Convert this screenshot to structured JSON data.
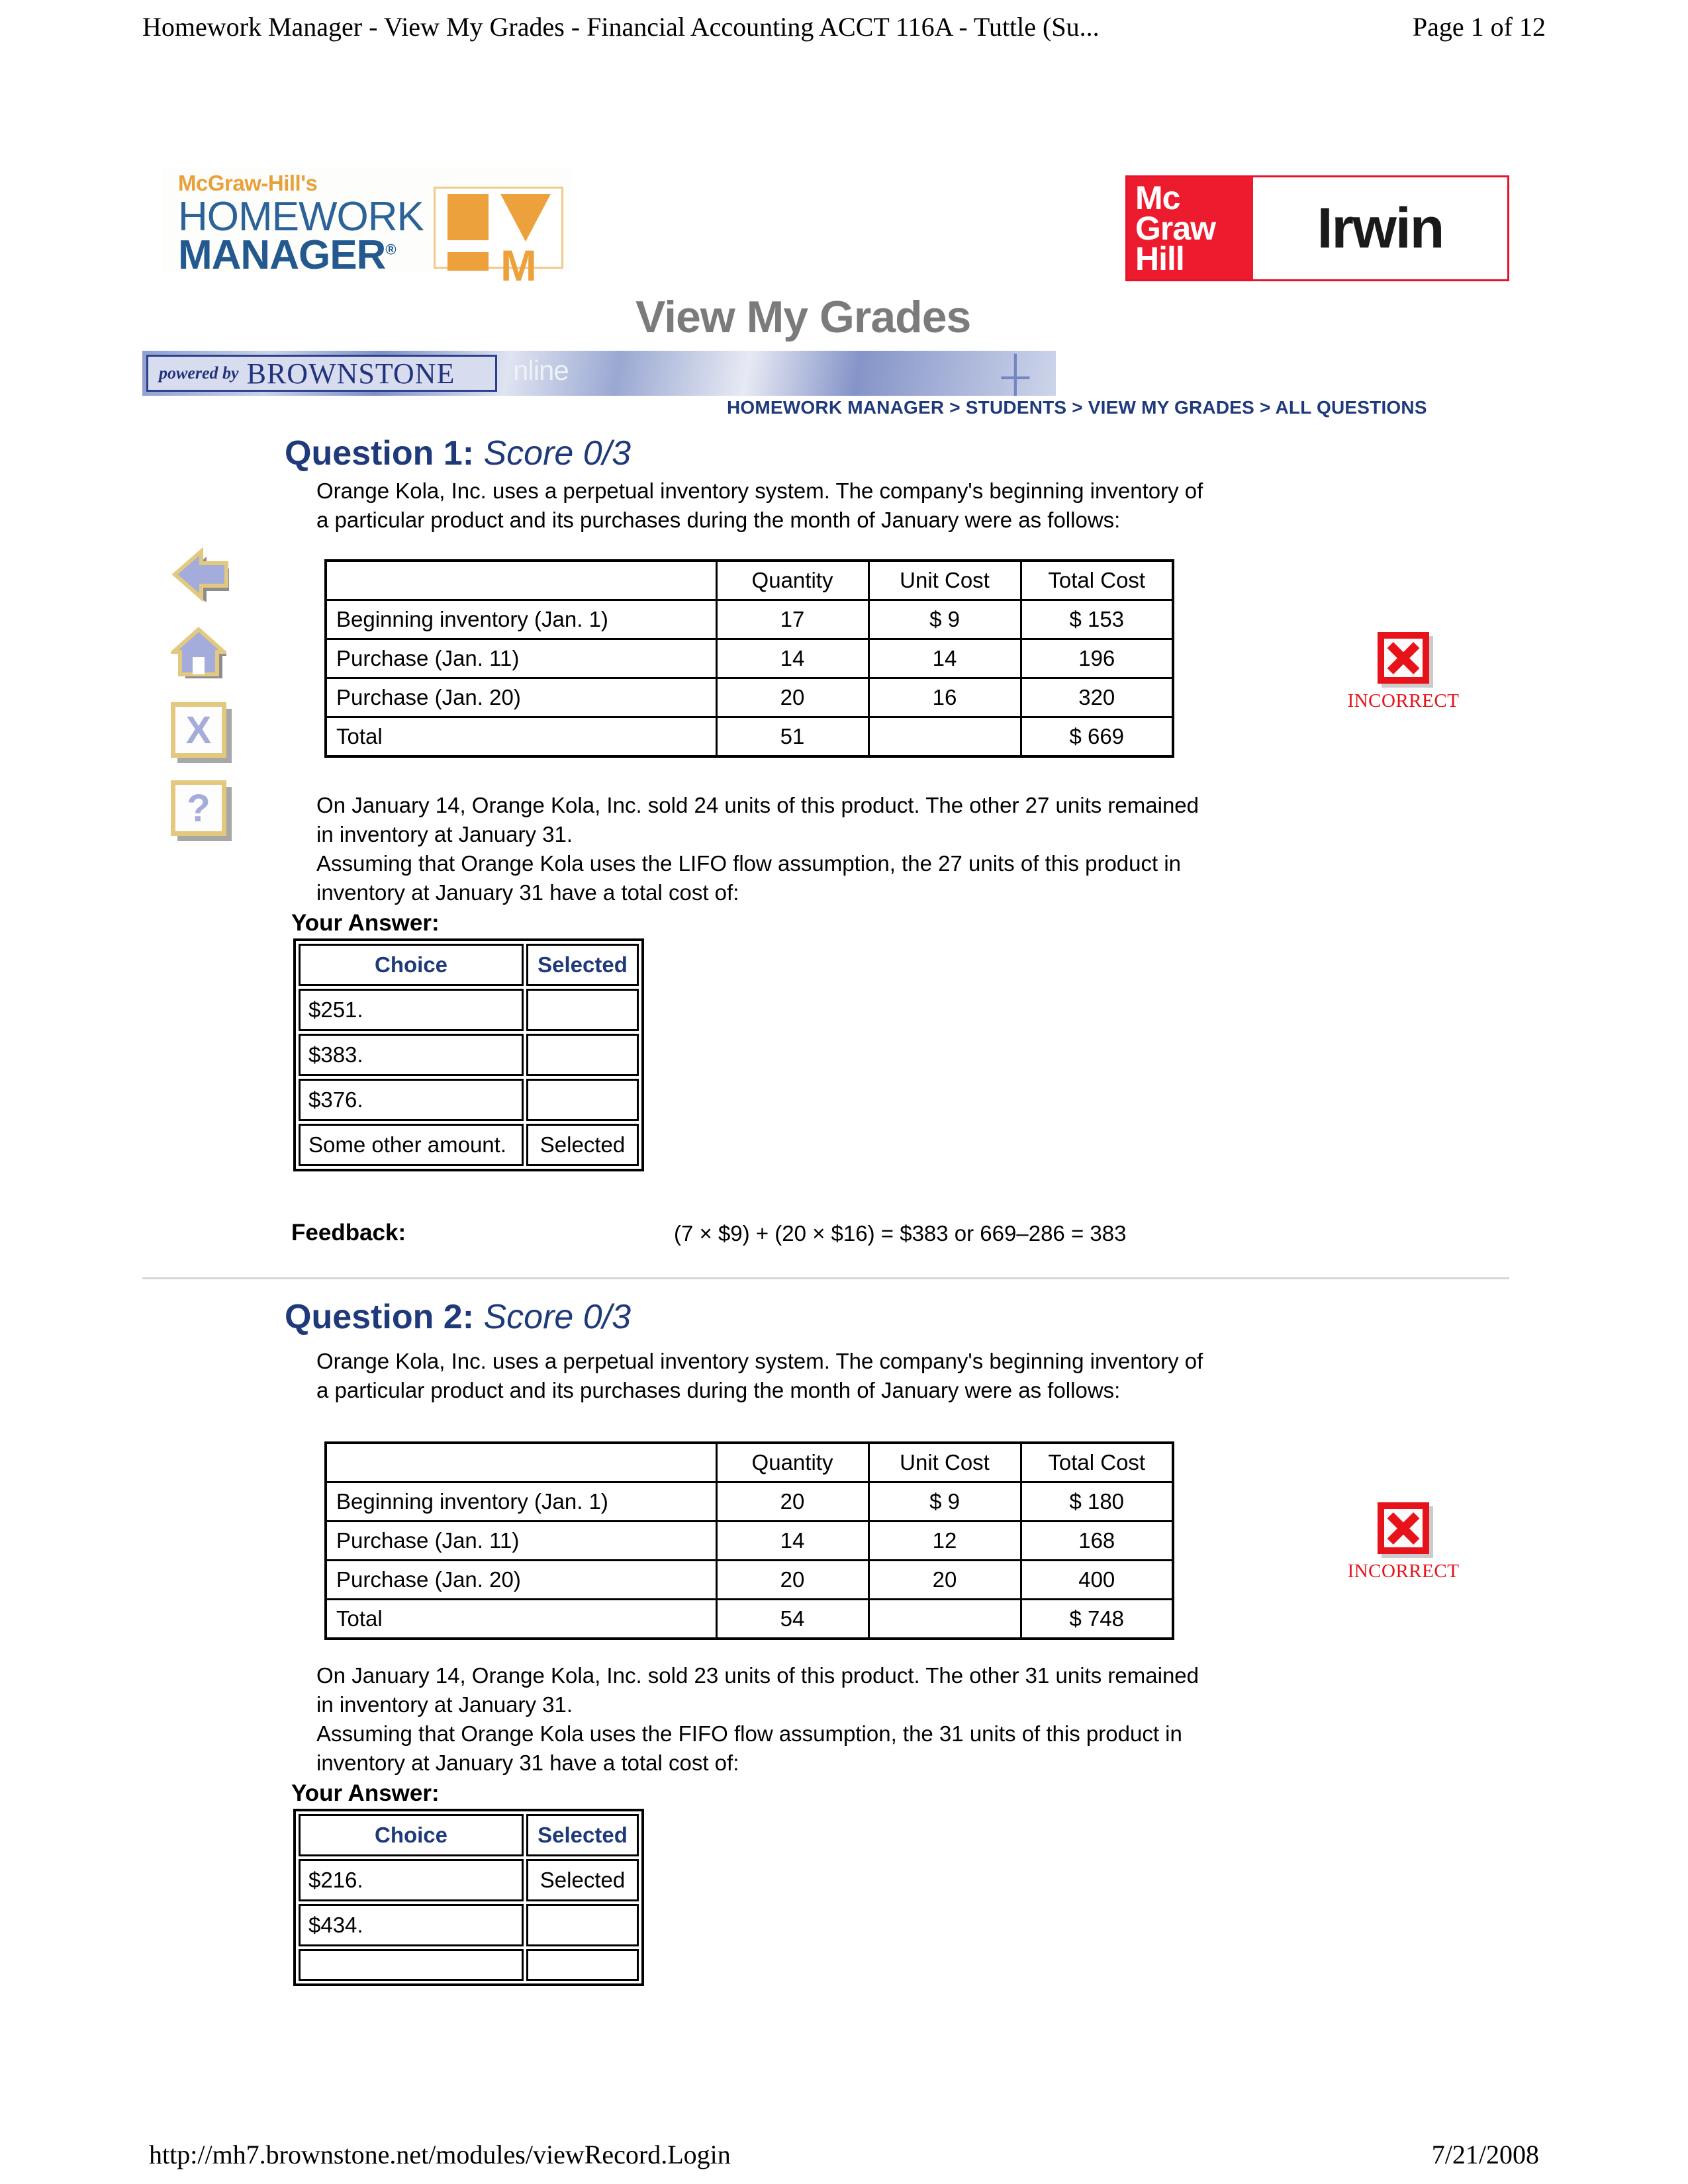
{
  "print": {
    "header_title": "Homework Manager - View My Grades - Financial Accounting ACCT 116A - Tuttle (Su...",
    "header_page": "Page 1 of 12",
    "footer_url": "http://mh7.brownstone.net/modules/viewRecord.Login",
    "footer_date": "7/21/2008"
  },
  "branding": {
    "hm_mcgraw": "McGraw-Hill's",
    "hm_homework": "HOMEWORK",
    "hm_manager": "MANAGER",
    "hm_reg": "®",
    "hm_mark_m": "M",
    "brownstone_powered": "powered by",
    "brownstone_name": "BROWNSTONE",
    "brownstone_online": "nline",
    "mhi_red": "Mc\nGraw\nHill",
    "mhi_irwin": "Irwin"
  },
  "page_title": "View My Grades",
  "breadcrumb": "HOMEWORK MANAGER > STUDENTS > VIEW MY GRADES > ALL QUESTIONS",
  "sidebar": {
    "items": [
      {
        "icon": "back-arrow-icon",
        "glyph": ""
      },
      {
        "icon": "home-icon",
        "glyph": ""
      },
      {
        "icon": "close-x-icon",
        "glyph": "X"
      },
      {
        "icon": "help-question-icon",
        "glyph": "?"
      }
    ]
  },
  "labels": {
    "your_answer": "Your Answer:",
    "feedback": "Feedback:",
    "choice_header": "Choice",
    "selected_header": "Selected",
    "selected_value": "Selected",
    "incorrect": "INCORRECT"
  },
  "colors": {
    "heading_blue": "#1f3a7a",
    "title_gray": "#7b7b7b",
    "incorrect_red": "#e8121a",
    "brand_orange": "#eda13c",
    "mcgraw_red": "#ed1b2e"
  },
  "questions": [
    {
      "number": "Question 1:",
      "score": "Score 0/3",
      "intro_line1": "Orange Kola, Inc. uses a perpetual inventory system. The company's beginning inventory of",
      "intro_line2": "a particular product and its purchases during the month of January were as follows:",
      "table": {
        "columns": [
          "",
          "Quantity",
          "Unit Cost",
          "Total Cost"
        ],
        "rows": [
          [
            "Beginning inventory (Jan. 1)",
            "17",
            "$ 9",
            "$ 153"
          ],
          [
            "Purchase (Jan. 11)",
            "14",
            "14",
            "196"
          ],
          [
            "Purchase (Jan. 20)",
            "20",
            "16",
            "320"
          ],
          [
            "Total",
            "51",
            "",
            "$ 669"
          ]
        ]
      },
      "body_line1": "On January 14, Orange Kola, Inc. sold 24 units of this product. The other 27 units remained",
      "body_line2": "in inventory at January 31.",
      "body_line3": "Assuming that Orange Kola uses the LIFO flow assumption, the 27 units of this product in",
      "body_line4": "inventory at January 31 have a total cost of:",
      "choices": [
        {
          "text": "$251.",
          "selected": ""
        },
        {
          "text": "$383.",
          "selected": ""
        },
        {
          "text": "$376.",
          "selected": ""
        },
        {
          "text": "Some other amount.",
          "selected": "Selected"
        }
      ],
      "feedback": "(7 × $9) + (20 × $16) = $383 or 669–286 = 383",
      "status": "INCORRECT"
    },
    {
      "number": "Question 2:",
      "score": "Score 0/3",
      "intro_line1": "Orange Kola, Inc. uses a perpetual inventory system. The company's beginning inventory of",
      "intro_line2": "a particular product and its purchases during the month of January were as follows:",
      "table": {
        "columns": [
          "",
          "Quantity",
          "Unit Cost",
          "Total Cost"
        ],
        "rows": [
          [
            "Beginning inventory (Jan. 1)",
            "20",
            "$ 9",
            "$ 180"
          ],
          [
            "Purchase (Jan. 11)",
            "14",
            "12",
            "168"
          ],
          [
            "Purchase (Jan. 20)",
            "20",
            "20",
            "400"
          ],
          [
            "Total",
            "54",
            "",
            "$ 748"
          ]
        ]
      },
      "body_line1": "On January 14, Orange Kola, Inc. sold 23 units of this product. The other 31 units remained",
      "body_line2": "in inventory at January 31.",
      "body_line3": "Assuming that Orange Kola uses the FIFO flow assumption, the 31 units of this product in",
      "body_line4": "inventory at January 31 have a total cost of:",
      "choices": [
        {
          "text": "$216.",
          "selected": "Selected"
        },
        {
          "text": "$434.",
          "selected": ""
        },
        {
          "text": "",
          "selected": ""
        }
      ],
      "status": "INCORRECT"
    }
  ]
}
